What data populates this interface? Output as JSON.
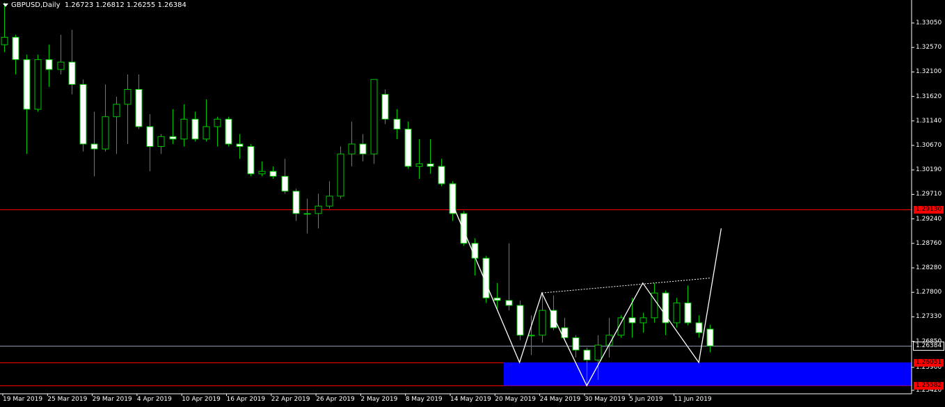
{
  "header": {
    "symbol": "GBPUSD,Daily",
    "ohlc": "1.26723 1.26812 1.26255 1.26384"
  },
  "colors": {
    "background": "#000000",
    "axis": "#ffffff",
    "bull_body": "#000000",
    "bear_body": "#ffffff",
    "wick": "#00c800",
    "resistance_line": "#ff0000",
    "current_line": "#8c9bb4",
    "zone": "#0000ff",
    "pattern": "#ffffff",
    "red_label_bg": "#ff0000",
    "white_label_bg": "#ffffff"
  },
  "price_axis": {
    "labels": [
      "1.33050",
      "1.32570",
      "1.32100",
      "1.31620",
      "1.31140",
      "1.30670",
      "1.30190",
      "1.29710",
      "1.29240",
      "1.28760",
      "1.28280",
      "1.27800",
      "1.27330",
      "1.26850",
      "1.25900",
      "1.25420"
    ]
  },
  "markers": {
    "current_price": "1.26384",
    "resistance": "1.29130",
    "zone_top": "1.26051",
    "zone_bottom": "1.25582"
  },
  "date_axis": {
    "labels": [
      "19 Mar 2019",
      "25 Mar 2019",
      "29 Mar 2019",
      "4 Apr 2019",
      "10 Apr 2019",
      "16 Apr 2019",
      "22 Apr 2019",
      "26 Apr 2019",
      "2 May 2019",
      "8 May 2019",
      "14 May 2019",
      "20 May 2019",
      "24 May 2019",
      "30 May 2019",
      "5 Jun 2019",
      "11 Jun 2019"
    ]
  },
  "chart_data": {
    "type": "candlestick",
    "instrument": "GBPUSD",
    "timeframe": "Daily",
    "ylim": [
      1.2542,
      1.3335
    ],
    "candles": [
      {
        "o": 1.3245,
        "h": 1.333,
        "l": 1.323,
        "c": 1.326
      },
      {
        "o": 1.326,
        "h": 1.3265,
        "l": 1.3185,
        "c": 1.3215
      },
      {
        "o": 1.3215,
        "h": 1.3225,
        "l": 1.3025,
        "c": 1.3115
      },
      {
        "o": 1.3115,
        "h": 1.3225,
        "l": 1.311,
        "c": 1.3215
      },
      {
        "o": 1.3215,
        "h": 1.3245,
        "l": 1.316,
        "c": 1.3195
      },
      {
        "o": 1.3195,
        "h": 1.3265,
        "l": 1.3185,
        "c": 1.321
      },
      {
        "o": 1.321,
        "h": 1.3275,
        "l": 1.3145,
        "c": 1.3165
      },
      {
        "o": 1.3165,
        "h": 1.3175,
        "l": 1.303,
        "c": 1.3045
      },
      {
        "o": 1.3045,
        "h": 1.311,
        "l": 1.298,
        "c": 1.3035
      },
      {
        "o": 1.3035,
        "h": 1.3165,
        "l": 1.303,
        "c": 1.31
      },
      {
        "o": 1.31,
        "h": 1.314,
        "l": 1.3025,
        "c": 1.3125
      },
      {
        "o": 1.3125,
        "h": 1.3185,
        "l": 1.3045,
        "c": 1.3155
      },
      {
        "o": 1.3155,
        "h": 1.3185,
        "l": 1.3075,
        "c": 1.308
      },
      {
        "o": 1.308,
        "h": 1.3105,
        "l": 1.299,
        "c": 1.304
      },
      {
        "o": 1.304,
        "h": 1.3065,
        "l": 1.3025,
        "c": 1.306
      },
      {
        "o": 1.306,
        "h": 1.3115,
        "l": 1.3045,
        "c": 1.3055
      },
      {
        "o": 1.3055,
        "h": 1.3125,
        "l": 1.304,
        "c": 1.3095
      },
      {
        "o": 1.3095,
        "h": 1.311,
        "l": 1.305,
        "c": 1.3055
      },
      {
        "o": 1.3055,
        "h": 1.3135,
        "l": 1.305,
        "c": 1.308
      },
      {
        "o": 1.308,
        "h": 1.31,
        "l": 1.304,
        "c": 1.3095
      },
      {
        "o": 1.3095,
        "h": 1.31,
        "l": 1.304,
        "c": 1.3045
      },
      {
        "o": 1.3045,
        "h": 1.3065,
        "l": 1.3015,
        "c": 1.304
      },
      {
        "o": 1.304,
        "h": 1.3045,
        "l": 1.298,
        "c": 1.2985
      },
      {
        "o": 1.2985,
        "h": 1.301,
        "l": 1.298,
        "c": 1.299
      },
      {
        "o": 1.299,
        "h": 1.3,
        "l": 1.2975,
        "c": 1.298
      },
      {
        "o": 1.298,
        "h": 1.3015,
        "l": 1.2945,
        "c": 1.295
      },
      {
        "o": 1.295,
        "h": 1.2955,
        "l": 1.289,
        "c": 1.2905
      },
      {
        "o": 1.2905,
        "h": 1.2935,
        "l": 1.2865,
        "c": 1.2905
      },
      {
        "o": 1.2905,
        "h": 1.2945,
        "l": 1.2875,
        "c": 1.292
      },
      {
        "o": 1.292,
        "h": 1.297,
        "l": 1.2915,
        "c": 1.294
      },
      {
        "o": 1.294,
        "h": 1.304,
        "l": 1.2935,
        "c": 1.3025
      },
      {
        "o": 1.3025,
        "h": 1.309,
        "l": 1.3,
        "c": 1.3045
      },
      {
        "o": 1.3045,
        "h": 1.3065,
        "l": 1.301,
        "c": 1.3025
      },
      {
        "o": 1.3025,
        "h": 1.3175,
        "l": 1.3005,
        "c": 1.3175
      },
      {
        "o": 1.3145,
        "h": 1.3155,
        "l": 1.3085,
        "c": 1.3095
      },
      {
        "o": 1.3095,
        "h": 1.3115,
        "l": 1.3055,
        "c": 1.3075
      },
      {
        "o": 1.3075,
        "h": 1.309,
        "l": 1.2995,
        "c": 1.3
      },
      {
        "o": 1.3,
        "h": 1.3055,
        "l": 1.2975,
        "c": 1.3005
      },
      {
        "o": 1.3005,
        "h": 1.3055,
        "l": 1.2985,
        "c": 1.3
      },
      {
        "o": 1.3,
        "h": 1.3015,
        "l": 1.296,
        "c": 1.2965
      },
      {
        "o": 1.2965,
        "h": 1.297,
        "l": 1.289,
        "c": 1.2905
      },
      {
        "o": 1.2905,
        "h": 1.291,
        "l": 1.284,
        "c": 1.2845
      },
      {
        "o": 1.2845,
        "h": 1.2855,
        "l": 1.278,
        "c": 1.2815
      },
      {
        "o": 1.2815,
        "h": 1.282,
        "l": 1.2725,
        "c": 1.2735
      },
      {
        "o": 1.2735,
        "h": 1.2765,
        "l": 1.271,
        "c": 1.273
      },
      {
        "o": 1.273,
        "h": 1.2845,
        "l": 1.271,
        "c": 1.272
      },
      {
        "o": 1.272,
        "h": 1.273,
        "l": 1.265,
        "c": 1.266
      },
      {
        "o": 1.266,
        "h": 1.27,
        "l": 1.262,
        "c": 1.266
      },
      {
        "o": 1.266,
        "h": 1.2745,
        "l": 1.2645,
        "c": 1.271
      },
      {
        "o": 1.271,
        "h": 1.274,
        "l": 1.267,
        "c": 1.2675
      },
      {
        "o": 1.2675,
        "h": 1.2695,
        "l": 1.265,
        "c": 1.2655
      },
      {
        "o": 1.2655,
        "h": 1.266,
        "l": 1.2615,
        "c": 1.263
      },
      {
        "o": 1.263,
        "h": 1.2635,
        "l": 1.256,
        "c": 1.261
      },
      {
        "o": 1.261,
        "h": 1.266,
        "l": 1.257,
        "c": 1.264
      },
      {
        "o": 1.264,
        "h": 1.2695,
        "l": 1.2615,
        "c": 1.266
      },
      {
        "o": 1.266,
        "h": 1.27,
        "l": 1.2655,
        "c": 1.2695
      },
      {
        "o": 1.2695,
        "h": 1.2735,
        "l": 1.2655,
        "c": 1.2685
      },
      {
        "o": 1.2685,
        "h": 1.2705,
        "l": 1.2665,
        "c": 1.2695
      },
      {
        "o": 1.2695,
        "h": 1.2765,
        "l": 1.2685,
        "c": 1.2745
      },
      {
        "o": 1.2745,
        "h": 1.275,
        "l": 1.266,
        "c": 1.2685
      },
      {
        "o": 1.2685,
        "h": 1.2735,
        "l": 1.2675,
        "c": 1.2725
      },
      {
        "o": 1.2725,
        "h": 1.276,
        "l": 1.268,
        "c": 1.2685
      },
      {
        "o": 1.2685,
        "h": 1.27,
        "l": 1.2655,
        "c": 1.2665
      },
      {
        "o": 1.26723,
        "h": 1.26812,
        "l": 1.26255,
        "c": 1.26384
      }
    ],
    "horizontal_lines": [
      {
        "price": 1.2913,
        "color": "red"
      },
      {
        "price": 1.26384,
        "color": "gray"
      },
      {
        "price": 1.26051,
        "color": "red"
      },
      {
        "price": 1.25582,
        "color": "red"
      }
    ],
    "zone": {
      "from_candle": 45,
      "top": 1.26051,
      "bottom": 1.25582
    },
    "pattern_path": [
      {
        "candle": 40,
        "price": 1.2925
      },
      {
        "candle": 46,
        "price": 1.2605
      },
      {
        "candle": 48,
        "price": 1.2745
      },
      {
        "candle": 52,
        "price": 1.25582
      },
      {
        "candle": 57,
        "price": 1.2765
      },
      {
        "candle": 62,
        "price": 1.2605
      },
      {
        "candle": 64,
        "price": 1.2875
      }
    ],
    "neckline": {
      "from_candle": 48,
      "from_price": 1.2745,
      "to_candle": 63,
      "to_price": 1.2775
    }
  }
}
